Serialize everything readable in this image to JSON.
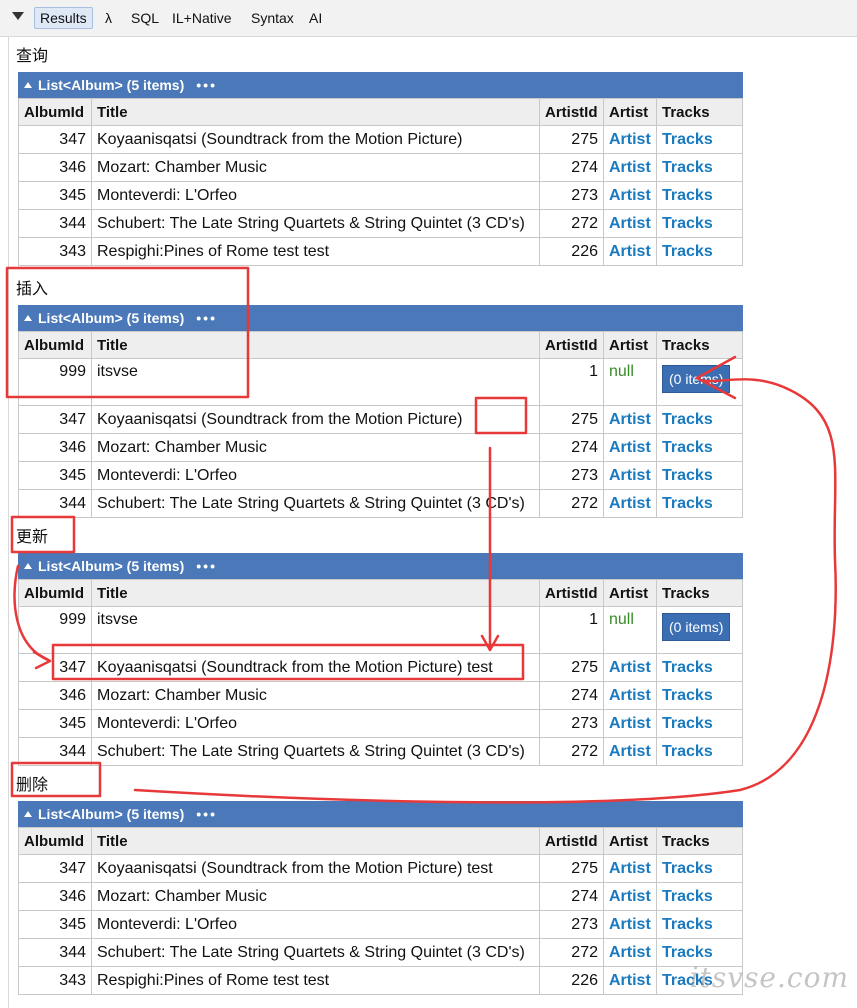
{
  "toolbar": {
    "items": [
      {
        "label": "Results",
        "active": true
      },
      {
        "label": "λ"
      },
      {
        "label": "SQL"
      },
      {
        "label": "IL+Native"
      },
      {
        "label": "Syntax"
      },
      {
        "label": "AI"
      }
    ]
  },
  "columns": [
    "AlbumId",
    "Title",
    "ArtistId",
    "Artist",
    "Tracks"
  ],
  "link_artist": "Artist",
  "link_tracks": "Tracks",
  "null_text": "null",
  "empty_items": "(0 items)",
  "sections": [
    {
      "label": "查询",
      "header": "List<Album> (5 items)",
      "rows": [
        {
          "id": "347",
          "title": "Koyaanisqatsi (Soundtrack from the Motion Picture)",
          "artist_id": "275"
        },
        {
          "id": "346",
          "title": "Mozart: Chamber Music",
          "artist_id": "274"
        },
        {
          "id": "345",
          "title": "Monteverdi: L'Orfeo",
          "artist_id": "273"
        },
        {
          "id": "344",
          "title": "Schubert: The Late String Quartets & String Quintet (3 CD's)",
          "artist_id": "272"
        },
        {
          "id": "343",
          "title": "Respighi:Pines of Rome test test",
          "artist_id": "226"
        }
      ]
    },
    {
      "label": "插入",
      "header": "List<Album> (5 items)",
      "rows": [
        {
          "id": "999",
          "title": "itsvse",
          "artist_id": "1",
          "null_artist": true
        },
        {
          "id": "347",
          "title": "Koyaanisqatsi (Soundtrack from the Motion Picture)",
          "artist_id": "275"
        },
        {
          "id": "346",
          "title": "Mozart: Chamber Music",
          "artist_id": "274"
        },
        {
          "id": "345",
          "title": "Monteverdi: L'Orfeo",
          "artist_id": "273"
        },
        {
          "id": "344",
          "title": "Schubert: The Late String Quartets & String Quintet (3 CD's)",
          "artist_id": "272"
        }
      ]
    },
    {
      "label": "更新",
      "header": "List<Album> (5 items)",
      "rows": [
        {
          "id": "999",
          "title": "itsvse",
          "artist_id": "1",
          "null_artist": true
        },
        {
          "id": "347",
          "title": "Koyaanisqatsi (Soundtrack from the Motion Picture) test",
          "artist_id": "275"
        },
        {
          "id": "346",
          "title": "Mozart: Chamber Music",
          "artist_id": "274"
        },
        {
          "id": "345",
          "title": "Monteverdi: L'Orfeo",
          "artist_id": "273"
        },
        {
          "id": "344",
          "title": "Schubert: The Late String Quartets & String Quintet (3 CD's)",
          "artist_id": "272"
        }
      ]
    },
    {
      "label": "删除",
      "header": "List<Album> (5 items)",
      "rows": [
        {
          "id": "347",
          "title": "Koyaanisqatsi (Soundtrack from the Motion Picture) test",
          "artist_id": "275"
        },
        {
          "id": "346",
          "title": "Mozart: Chamber Music",
          "artist_id": "274"
        },
        {
          "id": "345",
          "title": "Monteverdi: L'Orfeo",
          "artist_id": "273"
        },
        {
          "id": "344",
          "title": "Schubert: The Late String Quartets & String Quintet (3 CD's)",
          "artist_id": "272"
        },
        {
          "id": "343",
          "title": "Respighi:Pines of Rome test test",
          "artist_id": "226"
        }
      ]
    }
  ],
  "watermark": "itsvse.com",
  "annotation_color": "#e8393a"
}
